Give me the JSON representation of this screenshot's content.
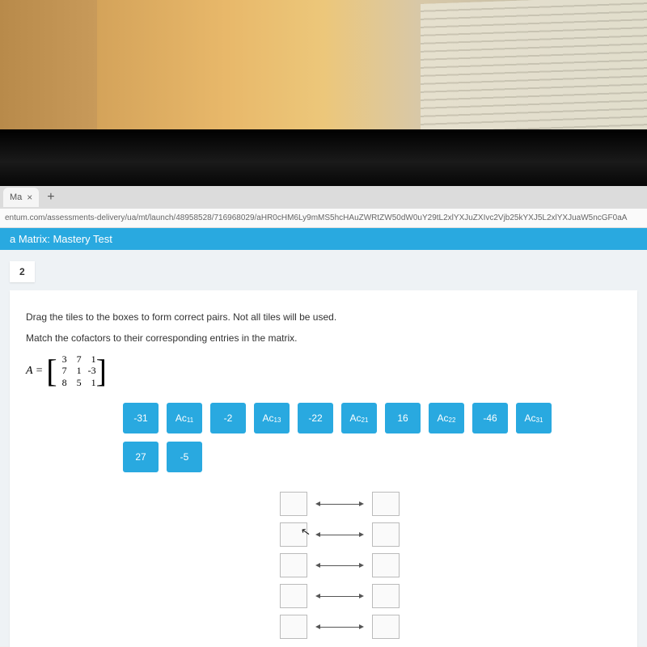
{
  "browser": {
    "tab_label": "Ma",
    "address": "entum.com/assessments-delivery/ua/mt/launch/48958528/716968029/aHR0cHM6Ly9mMS5hcHAuZWRtZW50dW0uY29tL2xlYXJuZXIvc2Vjb25kYXJ5L2xlYXJuaW5ncGF0aA"
  },
  "page": {
    "title": "a Matrix: Mastery Test",
    "question_number": "2",
    "instruction": "Drag the tiles to the boxes to form correct pairs. Not all tiles will be used.",
    "subinstruction": "Match the cofactors to their corresponding entries in the matrix.",
    "matrix_label": "A =",
    "matrix": {
      "r1": [
        "3",
        "7",
        "1"
      ],
      "r2": [
        "7",
        "1",
        "-3"
      ],
      "r3": [
        "8",
        "5",
        "1"
      ]
    }
  },
  "tiles": {
    "row": [
      {
        "text": "-31"
      },
      {
        "html": "Ac",
        "sub": "11"
      },
      {
        "text": "-2"
      },
      {
        "html": "Ac",
        "sub": "13"
      },
      {
        "text": "-22"
      },
      {
        "html": "Ac",
        "sub": "21"
      },
      {
        "text": "16"
      },
      {
        "html": "Ac",
        "sub": "22"
      },
      {
        "text": "-46"
      },
      {
        "html": "Ac",
        "sub": "31"
      },
      {
        "text": "27"
      },
      {
        "text": "-5"
      }
    ]
  }
}
